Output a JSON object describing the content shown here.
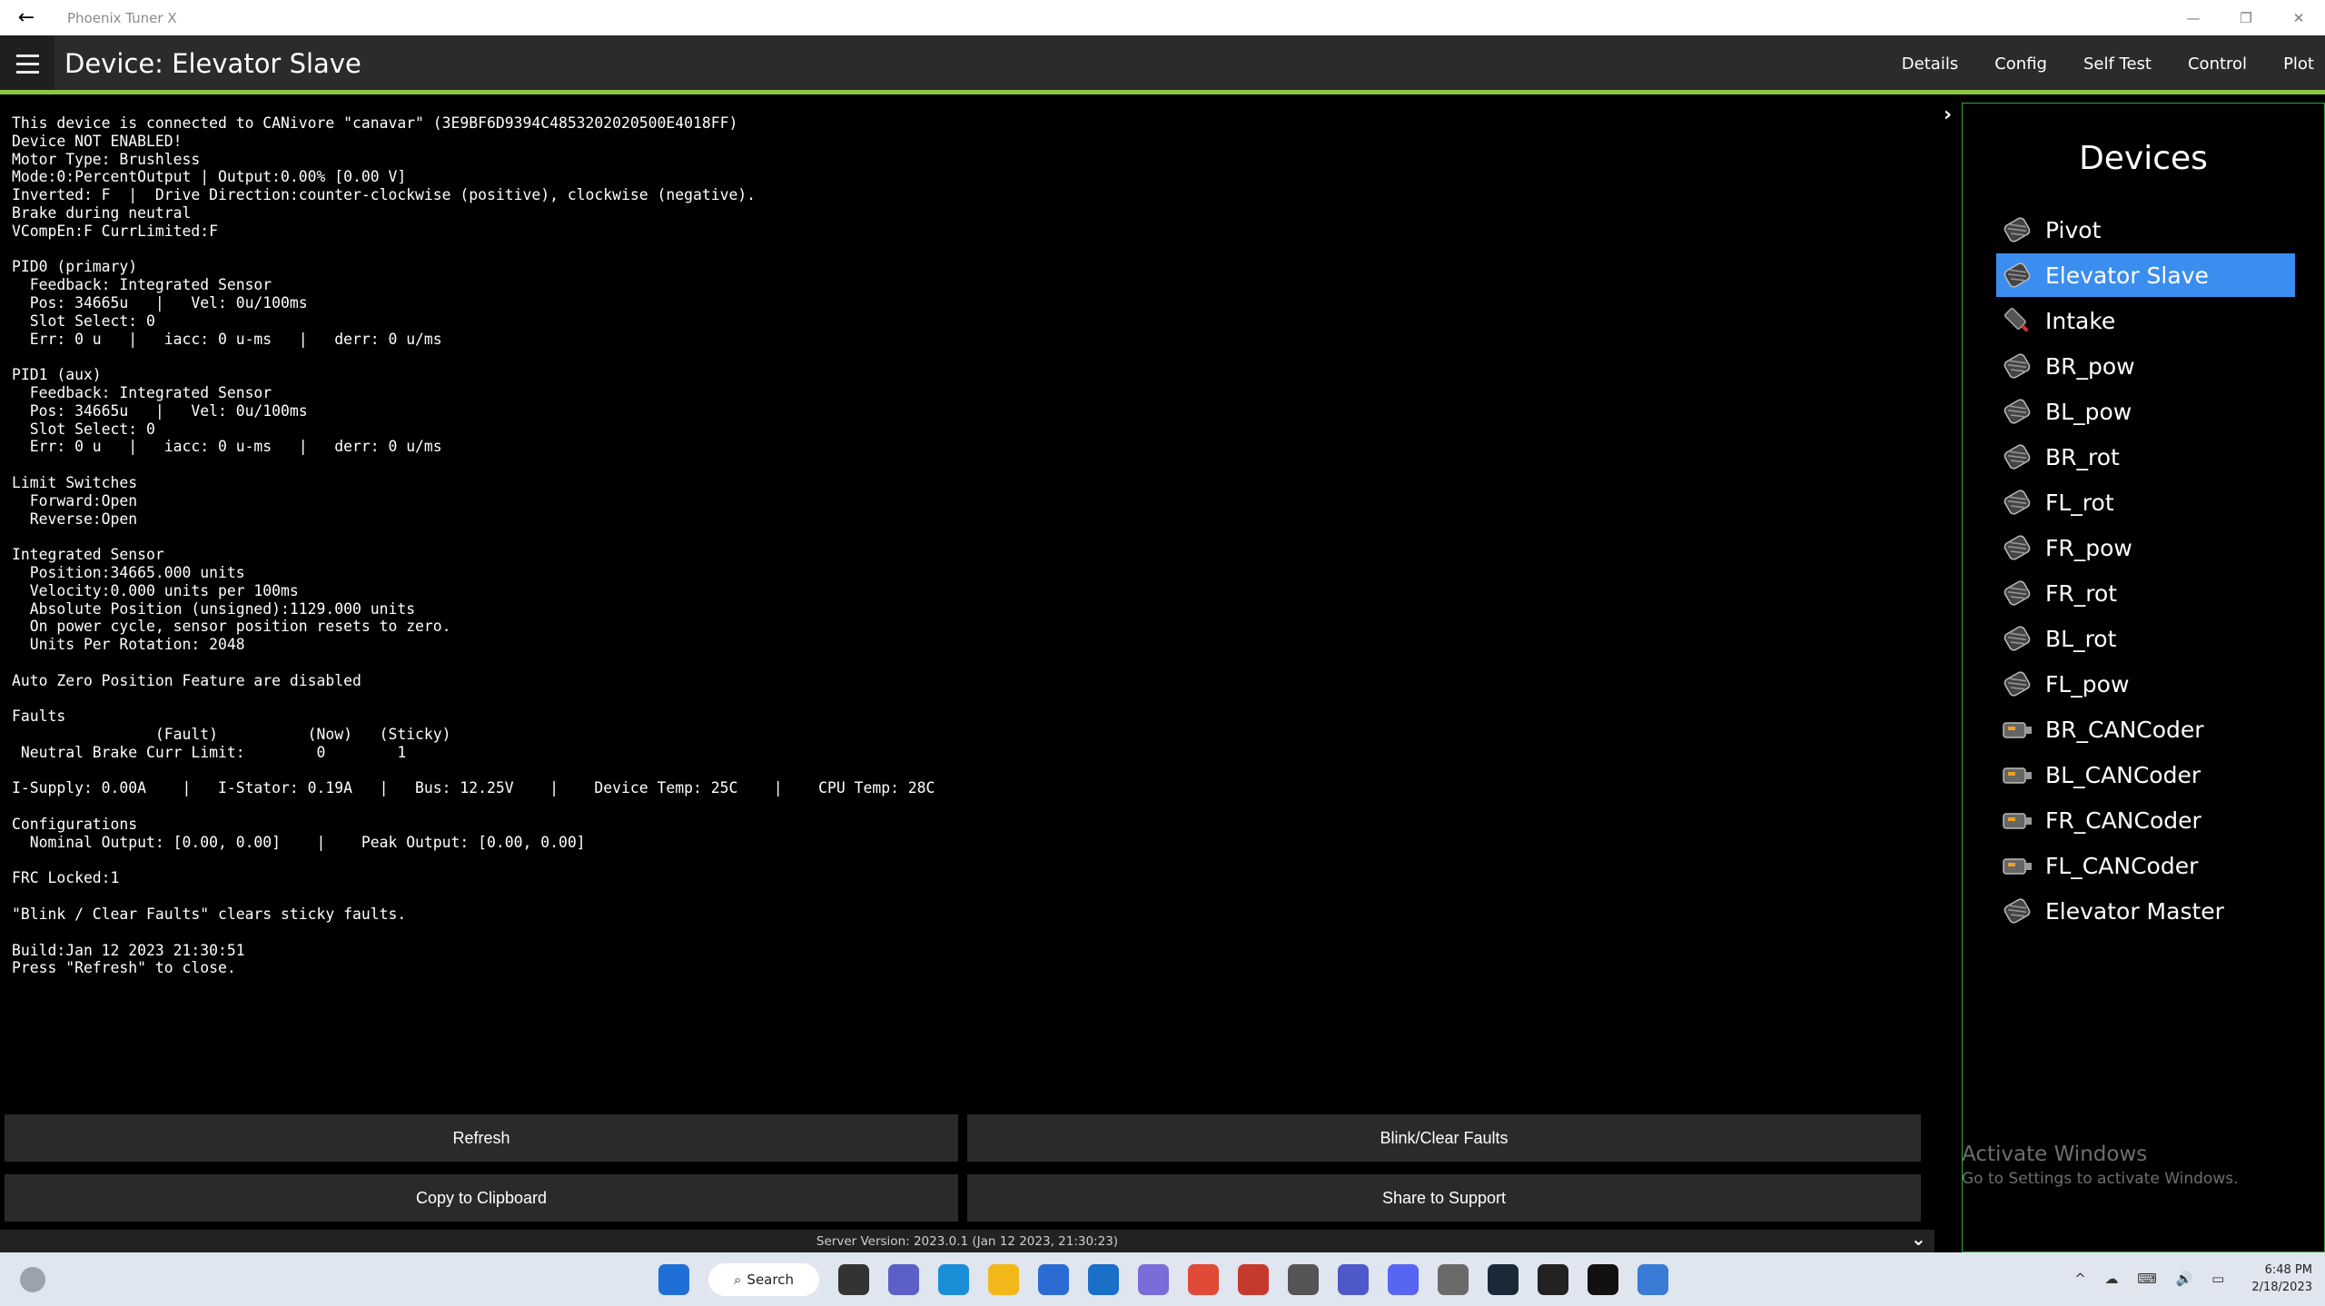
{
  "window": {
    "title": "Phoenix Tuner X",
    "back_glyph": "←",
    "minimize_glyph": "—",
    "restore_glyph": "❐",
    "close_glyph": "✕"
  },
  "header": {
    "title": "Device: Elevator Slave",
    "tabs": [
      "Details",
      "Config",
      "Self Test",
      "Control",
      "Plot"
    ]
  },
  "console_lines": [
    "This device is connected to CANivore \"canavar\" (3E9BF6D9394C4853202020500E4018FF)",
    "Device NOT ENABLED!",
    "Motor Type: Brushless",
    "Mode:0:PercentOutput | Output:0.00% [0.00 V]",
    "Inverted: F  |  Drive Direction:counter-clockwise (positive), clockwise (negative).",
    "Brake during neutral",
    "VCompEn:F CurrLimited:F",
    "",
    "PID0 (primary)",
    "  Feedback: Integrated Sensor",
    "  Pos: 34665u   |   Vel: 0u/100ms",
    "  Slot Select: 0",
    "  Err: 0 u   |   iacc: 0 u-ms   |   derr: 0 u/ms",
    "",
    "PID1 (aux)",
    "  Feedback: Integrated Sensor",
    "  Pos: 34665u   |   Vel: 0u/100ms",
    "  Slot Select: 0",
    "  Err: 0 u   |   iacc: 0 u-ms   |   derr: 0 u/ms",
    "",
    "Limit Switches",
    "  Forward:Open",
    "  Reverse:Open",
    "",
    "Integrated Sensor",
    "  Position:34665.000 units",
    "  Velocity:0.000 units per 100ms",
    "  Absolute Position (unsigned):1129.000 units",
    "  On power cycle, sensor position resets to zero.",
    "  Units Per Rotation: 2048",
    "",
    "Auto Zero Position Feature are disabled",
    "",
    "Faults",
    "                (Fault)          (Now)   (Sticky)",
    " Neutral Brake Curr Limit:        0        1",
    "",
    "I-Supply: 0.00A    |   I-Stator: 0.19A   |   Bus: 12.25V    |    Device Temp: 25C    |    CPU Temp: 28C",
    "",
    "Configurations",
    "  Nominal Output: [0.00, 0.00]    |    Peak Output: [0.00, 0.00]",
    "",
    "FRC Locked:1",
    "",
    "\"Blink / Clear Faults\" clears sticky faults.",
    "",
    "Build:Jan 12 2023 21:30:51",
    "Press \"Refresh\" to close."
  ],
  "devices": {
    "title": "Devices",
    "selected_index": 1,
    "items": [
      {
        "label": "Pivot",
        "icon": "talon-motor-icon"
      },
      {
        "label": "Elevator Slave",
        "icon": "talon-motor-icon"
      },
      {
        "label": "Intake",
        "icon": "motor-controller-icon"
      },
      {
        "label": "BR_pow",
        "icon": "talon-motor-icon"
      },
      {
        "label": "BL_pow",
        "icon": "talon-motor-icon"
      },
      {
        "label": "BR_rot",
        "icon": "talon-motor-icon"
      },
      {
        "label": "FL_rot",
        "icon": "talon-motor-icon"
      },
      {
        "label": "FR_pow",
        "icon": "talon-motor-icon"
      },
      {
        "label": "FR_rot",
        "icon": "talon-motor-icon"
      },
      {
        "label": "BL_rot",
        "icon": "talon-motor-icon"
      },
      {
        "label": "FL_pow",
        "icon": "talon-motor-icon"
      },
      {
        "label": "BR_CANCoder",
        "icon": "cancoder-icon"
      },
      {
        "label": "BL_CANCoder",
        "icon": "cancoder-icon"
      },
      {
        "label": "FR_CANCoder",
        "icon": "cancoder-icon"
      },
      {
        "label": "FL_CANCoder",
        "icon": "cancoder-icon"
      },
      {
        "label": "Elevator Master",
        "icon": "talon-motor-icon"
      }
    ]
  },
  "buttons": {
    "refresh": "Refresh",
    "blink": "Blink/Clear Faults",
    "copy": "Copy to Clipboard",
    "share": "Share to Support"
  },
  "status": {
    "server_version": "Server Version:  2023.0.1 (Jan 12 2023, 21:30:23)"
  },
  "watermark": {
    "line1": "Activate Windows",
    "line2": "Go to Settings to activate Windows."
  },
  "taskbar": {
    "search_label": "Search",
    "time": "6:48 PM",
    "date": "2/18/2023",
    "tray_glyphs": "^ ☁ ⌨ 🔊 ▭",
    "app_icons": [
      {
        "name": "start-icon",
        "color": "#1f6fd6"
      },
      {
        "name": "task-view-icon",
        "color": "#333333"
      },
      {
        "name": "chat-icon",
        "color": "#5b5fc7"
      },
      {
        "name": "edge-icon",
        "color": "#1a8fd8"
      },
      {
        "name": "file-explorer-icon",
        "color": "#f2b81a"
      },
      {
        "name": "store-icon",
        "color": "#2b6cd4"
      },
      {
        "name": "mail-icon",
        "color": "#1a6fc8"
      },
      {
        "name": "copilot-icon",
        "color": "#7a6cd9"
      },
      {
        "name": "chrome-icon",
        "color": "#e04a37"
      },
      {
        "name": "driver-station-icon",
        "color": "#c63a2e"
      },
      {
        "name": "inkscape-icon",
        "color": "#555555"
      },
      {
        "name": "teams-icon",
        "color": "#4e58c9"
      },
      {
        "name": "discord-icon",
        "color": "#5865f2"
      },
      {
        "name": "game-icon",
        "color": "#6a6a6a"
      },
      {
        "name": "steam-icon",
        "color": "#1b2838"
      },
      {
        "name": "media-player-icon",
        "color": "#222222"
      },
      {
        "name": "ctre-icon",
        "color": "#111111"
      },
      {
        "name": "phoenix-tuner-icon",
        "color": "#3a7bd5"
      }
    ]
  }
}
